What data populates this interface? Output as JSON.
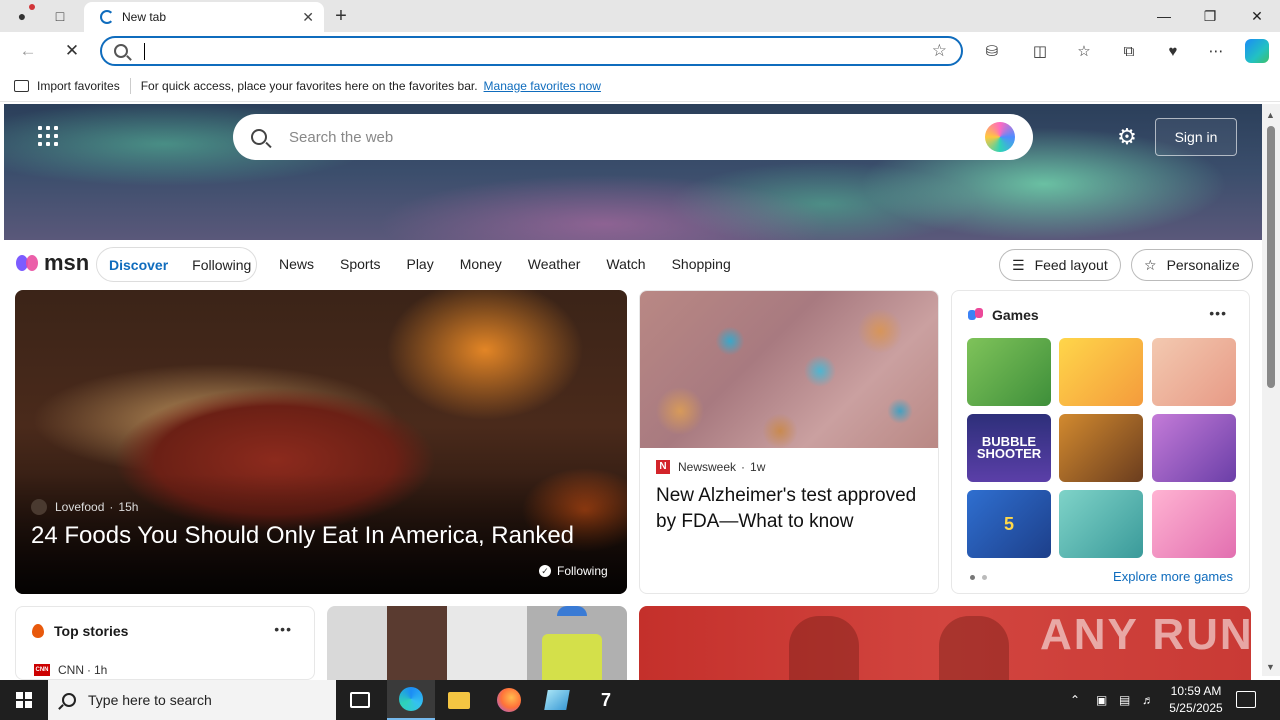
{
  "browser": {
    "tab_title": "New tab",
    "address_value": "",
    "favorites_bar": {
      "import_label": "Import favorites",
      "message": "For quick access, place your favorites here on the favorites bar.",
      "manage_link": "Manage favorites now"
    }
  },
  "hero": {
    "search_placeholder": "Search the web",
    "signin_label": "Sign in"
  },
  "msn": {
    "logo_text": "msn",
    "pill": {
      "discover": "Discover",
      "following": "Following"
    },
    "nav": [
      "News",
      "Sports",
      "Play",
      "Money",
      "Weather",
      "Watch",
      "Shopping"
    ],
    "feed_layout": "Feed layout",
    "personalize": "Personalize"
  },
  "cards": {
    "food": {
      "source": "Lovefood",
      "age": "15h",
      "title": "24 Foods You Should Only Eat In America, Ranked",
      "badge": "Following"
    },
    "alzheimer": {
      "source": "Newsweek",
      "age": "1w",
      "title": "New Alzheimer's test approved by FDA—What to know"
    },
    "games": {
      "heading": "Games",
      "tiles": [
        {
          "name": "pull-pin",
          "label": ""
        },
        {
          "name": "cake-puzzle",
          "label": ""
        },
        {
          "name": "dress-up",
          "label": ""
        },
        {
          "name": "bubble-shooter",
          "label": "BUBBLE SHOOTER"
        },
        {
          "name": "story-girl",
          "label": ""
        },
        {
          "name": "makeup-brushes",
          "label": ""
        },
        {
          "name": "fish-five",
          "label": "5"
        },
        {
          "name": "hospital",
          "label": ""
        },
        {
          "name": "princess",
          "label": ""
        }
      ],
      "explore_label": "Explore more games"
    },
    "top_stories": {
      "heading": "Top stories",
      "source": "CNN",
      "age": "1h"
    }
  },
  "taskbar": {
    "search_placeholder": "Type here to search",
    "time": "10:59 AM",
    "date": "5/25/2025"
  },
  "watermark": "ANY RUN"
}
